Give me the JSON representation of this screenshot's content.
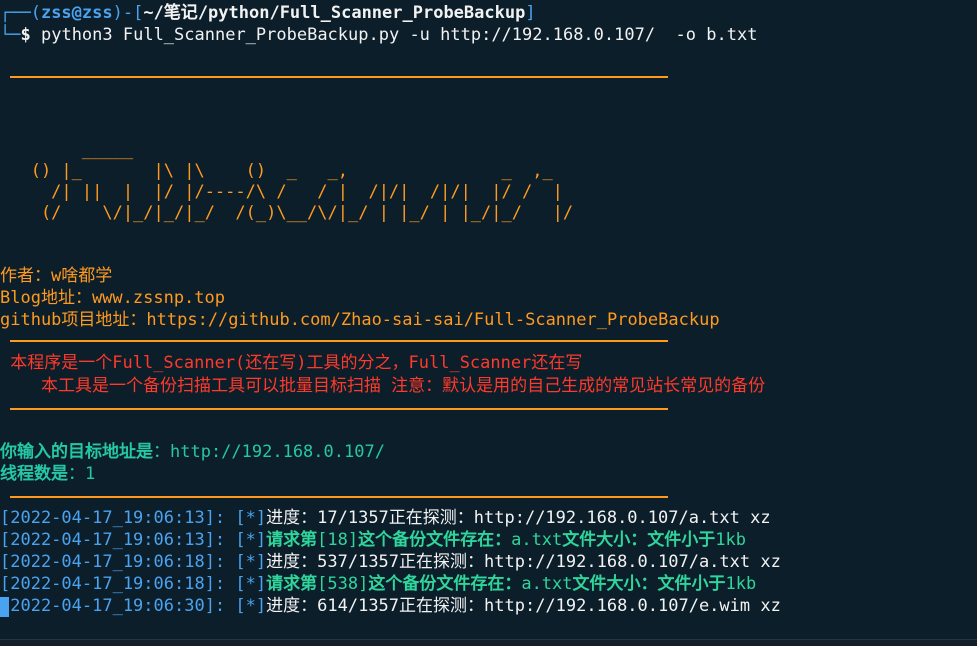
{
  "colors": {
    "background": "#0c1e2a",
    "prompt": "#4aa3f0",
    "banner": "#ff9a1f",
    "notice": "#ff3a2a",
    "info": "#25c7a4",
    "found": "#2fd59b"
  },
  "prompt": {
    "user_host": "zss@zss",
    "path_prefix": "~/",
    "path_cn": "笔记",
    "path_rest": "/python/Full_Scanner_ProbeBackup",
    "dollar": "$",
    "command": "python3 Full_Scanner_ProbeBackup.py -u http://192.168.0.107/  -o b.txt"
  },
  "banner": {
    "ascii_art": "        _____\n   () |_       |\\ |\\    ()  _   _,               _  ,_\n     /| ||  |  |/ |/----/\\ /   / |  /|/|  /|/|  |/ /  |\n    (/    \\/|_/|_/|_/  /(_)\\__/\\/|_/ | |_/ | |_/|_/   |/",
    "author": "作者：w啥都学",
    "blog": "Blog地址：www.zssnp.top",
    "github": "github项目地址：https://github.com/Zhao-sai-sai/Full-Scanner_ProbeBackup"
  },
  "notice": {
    "line1": " 本程序是一个Full_Scanner(还在写)工具的分之，Full_Scanner还在写",
    "line2": "    本工具是一个备份扫描工具可以批量目标扫描 注意：默认是用的自己生成的常见站长常见的备份"
  },
  "target": {
    "label": "你输入的目标地址是",
    "value": "：http://192.168.0.107/"
  },
  "threads": {
    "label": "线程数是",
    "value": "：1"
  },
  "log": [
    {
      "ts": "[2022-04-17_19:06:13]:",
      "tag": "[*]",
      "kind": "progress",
      "text": "进度：17/1357正在探测：http://192.168.0.107/a.txt xz"
    },
    {
      "ts": "[2022-04-17_19:06:13]:",
      "tag": "[*]",
      "kind": "found",
      "a": "请求第",
      "b": "[18]",
      "c": "这个备份文件存在：",
      "d": "a.txt",
      "e": "文件大小：文件小于",
      "f": "1kb"
    },
    {
      "ts": "[2022-04-17_19:06:18]:",
      "tag": "[*]",
      "kind": "progress",
      "text": "进度：537/1357正在探测：http://192.168.0.107/a.txt xz"
    },
    {
      "ts": "[2022-04-17_19:06:18]:",
      "tag": "[*]",
      "kind": "found",
      "a": "请求第",
      "b": "[538]",
      "c": "这个备份文件存在：",
      "d": "a.txt",
      "e": "文件大小：文件小于",
      "f": "1kb"
    },
    {
      "ts": "[2022-04-17_19:06:30]:",
      "tag": "[*]",
      "kind": "progress",
      "text": "进度：614/1357正在探测：http://192.168.0.107/e.wim xz"
    }
  ]
}
